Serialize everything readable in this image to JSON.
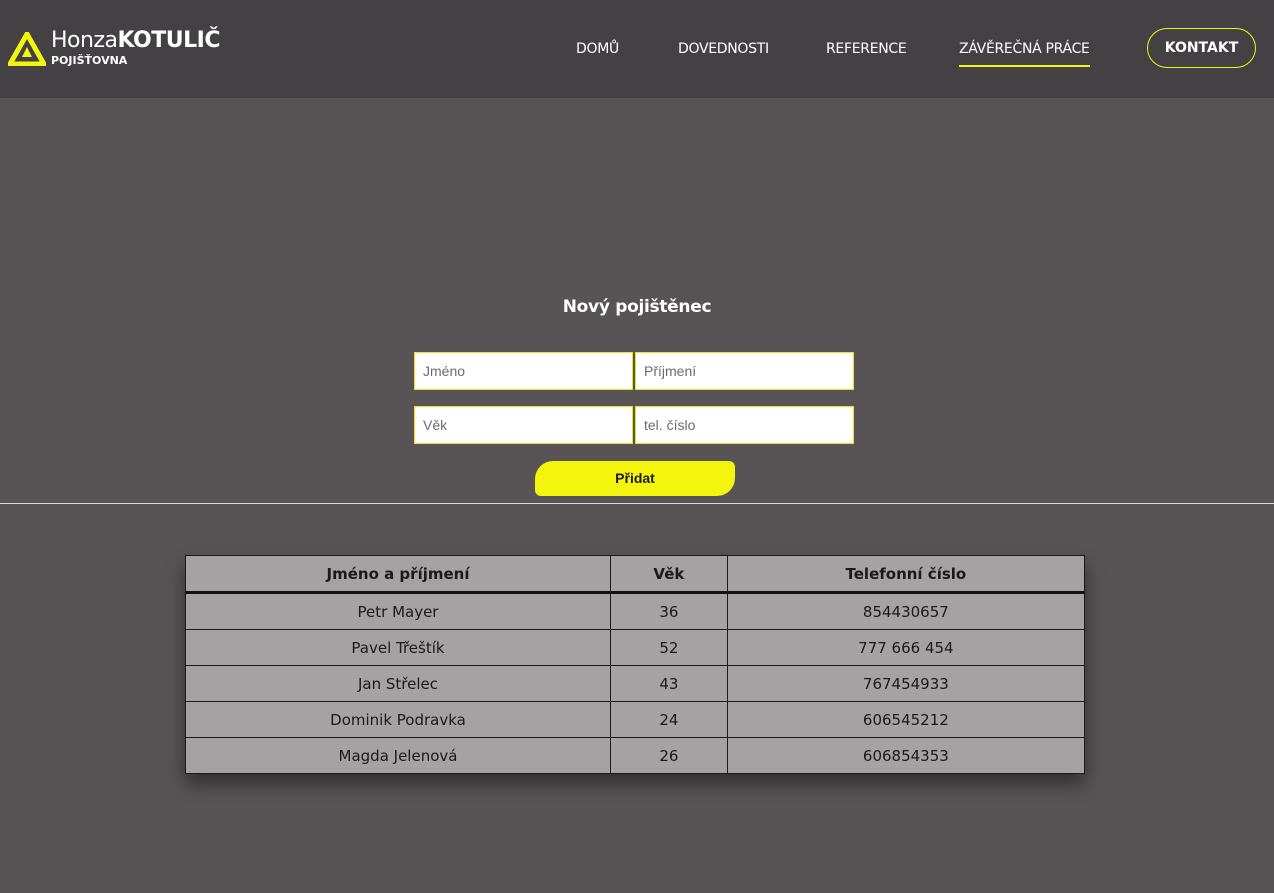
{
  "brand": {
    "first_name": "Honza",
    "last_name": "KOTULIČ",
    "subtitle": "POJIŠŤOVNA",
    "logo_icon": "triangle-logo-icon",
    "accent_color": "#f4f50d"
  },
  "nav": {
    "items": [
      {
        "label": "DOMŮ"
      },
      {
        "label": "DOVEDNOSTI"
      },
      {
        "label": "REFERENCE"
      },
      {
        "label": "ZÁVĚREČNÁ PRÁCE",
        "active": true
      }
    ],
    "cta_label": "KONTAKT"
  },
  "form": {
    "title": "Nový pojištěnec",
    "first_name_placeholder": "Jméno",
    "last_name_placeholder": "Příjmení",
    "age_placeholder": "Věk",
    "phone_placeholder": "tel. číslo",
    "submit_label": "Přidat"
  },
  "table": {
    "headers": [
      "Jméno a příjmení",
      "Věk",
      "Telefonní číslo"
    ],
    "rows": [
      [
        "Petr Mayer",
        "36",
        "854430657"
      ],
      [
        "Pavel Třeštík",
        "52",
        "777 666 454"
      ],
      [
        "Jan Střelec",
        "43",
        "767454933"
      ],
      [
        "Dominik Podravka",
        "24",
        "606545212"
      ],
      [
        "Magda Jelenová",
        "26",
        "606854353"
      ]
    ]
  }
}
